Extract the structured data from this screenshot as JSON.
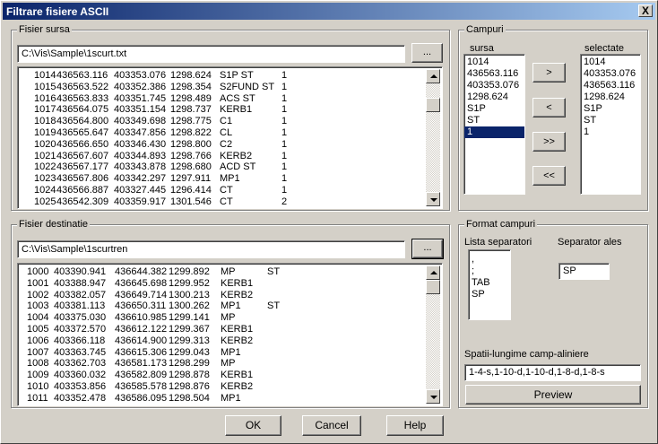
{
  "window": {
    "title": "Filtrare fisiere ASCII",
    "close_symbol": "X"
  },
  "source": {
    "legend": "Fisier sursa",
    "path": "C:\\Vis\\Sample\\1scurt.txt",
    "browse_label": "...",
    "rows": [
      [
        "1014",
        "436563.116",
        "403353.076",
        "1298.624",
        "S1P ST",
        "1"
      ],
      [
        "1015",
        "436563.522",
        "403352.386",
        "1298.354",
        "S2FUND ST",
        "1"
      ],
      [
        "1016",
        "436563.833",
        "403351.745",
        "1298.489",
        "ACS ST",
        "1"
      ],
      [
        "1017",
        "436564.075",
        "403351.154",
        "1298.737",
        "KERB1",
        "1"
      ],
      [
        "1018",
        "436564.800",
        "403349.698",
        "1298.775",
        "C1",
        "1"
      ],
      [
        "1019",
        "436565.647",
        "403347.856",
        "1298.822",
        "CL",
        "1"
      ],
      [
        "1020",
        "436566.650",
        "403346.430",
        "1298.800",
        "C2",
        "1"
      ],
      [
        "1021",
        "436567.607",
        "403344.893",
        "1298.766",
        "KERB2",
        "1"
      ],
      [
        "1022",
        "436567.177",
        "403343.878",
        "1298.680",
        "ACD ST",
        "1"
      ],
      [
        "1023",
        "436567.806",
        "403342.297",
        "1297.911",
        "MP1",
        "1"
      ],
      [
        "1024",
        "436566.887",
        "403327.445",
        "1296.414",
        "CT",
        "1"
      ],
      [
        "1025",
        "436542.309",
        "403359.917",
        "1301.546",
        "CT",
        "2"
      ]
    ]
  },
  "destination": {
    "legend": "Fisier destinatie",
    "path": "C:\\Vis\\Sample\\1scurtren",
    "browse_label": "...",
    "rows": [
      [
        "1000",
        "403390.941",
        "436644.382",
        "1299.892",
        "MP",
        "ST"
      ],
      [
        "1001",
        "403388.947",
        "436645.698",
        "1299.952",
        "KERB1",
        ""
      ],
      [
        "1002",
        "403382.057",
        "436649.714",
        "1300.213",
        "KERB2",
        ""
      ],
      [
        "1003",
        "403381.113",
        "436650.311",
        "1300.262",
        "MP1",
        "ST"
      ],
      [
        "1004",
        "403375.030",
        "436610.985",
        "1299.141",
        "MP",
        ""
      ],
      [
        "1005",
        "403372.570",
        "436612.122",
        "1299.367",
        "KERB1",
        ""
      ],
      [
        "1006",
        "403366.118",
        "436614.900",
        "1299.313",
        "KERB2",
        ""
      ],
      [
        "1007",
        "403363.745",
        "436615.306",
        "1299.043",
        "MP1",
        ""
      ],
      [
        "1008",
        "403362.703",
        "436581.173",
        "1298.299",
        "MP",
        ""
      ],
      [
        "1009",
        "403360.032",
        "436582.809",
        "1298.878",
        "KERB1",
        ""
      ],
      [
        "1010",
        "403353.856",
        "436585.578",
        "1298.876",
        "KERB2",
        ""
      ],
      [
        "1011",
        "403352.478",
        "436586.095",
        "1298.504",
        "MP1",
        ""
      ]
    ]
  },
  "fields": {
    "legend": "Campuri",
    "source_label": "sursa",
    "selected_label": "selectate",
    "source_items": [
      "1014",
      "436563.116",
      "403353.076",
      "1298.624",
      "S1P",
      "ST",
      "1"
    ],
    "source_selected_index": 6,
    "selected_items": [
      "1014",
      "403353.076",
      "436563.116",
      "1298.624",
      "S1P",
      "ST",
      "1"
    ],
    "btn_add": ">",
    "btn_remove": "<",
    "btn_add_all": ">>",
    "btn_remove_all": "<<"
  },
  "format": {
    "legend": "Format campuri",
    "separators_label": "Lista separatori",
    "separators": [
      ",",
      ";",
      "TAB",
      "SP"
    ],
    "chosen_label": "Separator ales",
    "chosen_value": "SP",
    "spacing_label": "Spatii-lungime camp-aliniere",
    "spacing_value": "1-4-s,1-10-d,1-10-d,1-8-d,1-8-s",
    "preview_label": "Preview"
  },
  "footer": {
    "ok": "OK",
    "cancel": "Cancel",
    "help": "Help"
  }
}
